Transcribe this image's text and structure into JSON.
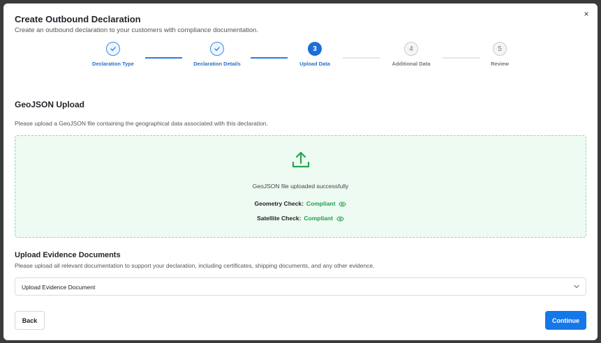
{
  "modal": {
    "title": "Create Outbound Declaration",
    "subtitle": "Create an outbound declaration to your customers with compliance documentation.",
    "close_glyph": "×"
  },
  "stepper": {
    "steps": [
      {
        "number": "1",
        "label": "Declaration Type",
        "state": "done"
      },
      {
        "number": "2",
        "label": "Declaration Details",
        "state": "done"
      },
      {
        "number": "3",
        "label": "Upload Data",
        "state": "active"
      },
      {
        "number": "4",
        "label": "Additional Data",
        "state": "todo"
      },
      {
        "number": "5",
        "label": "Review",
        "state": "todo"
      }
    ]
  },
  "geojson": {
    "title": "GeoJSON Upload",
    "description": "Please upload a GeoJSON file containing the geographical data associated with this declaration.",
    "upload_message": "GeoJSON file uploaded successfully",
    "geometry_label": "Geometry Check:",
    "geometry_value": "Compliant",
    "satellite_label": "Satellite Check:",
    "satellite_value": "Compliant"
  },
  "evidence": {
    "title": "Upload Evidence Documents",
    "description": "Please upload all relevant documentation to support your declaration, including certificates, shipping documents, and any other evidence.",
    "select_value": "Upload Evidence Document"
  },
  "footer": {
    "back_label": "Back",
    "continue_label": "Continue"
  },
  "colors": {
    "primary": "#1677e8",
    "success": "#1f9d4a",
    "dropzone_bg": "#eefbf2",
    "dropzone_border": "#8fd9a8"
  },
  "icons": {
    "close": "close-icon",
    "check": "check-icon",
    "upload": "upload-icon",
    "eye": "eye-icon",
    "chevron": "chevron-down-icon"
  }
}
